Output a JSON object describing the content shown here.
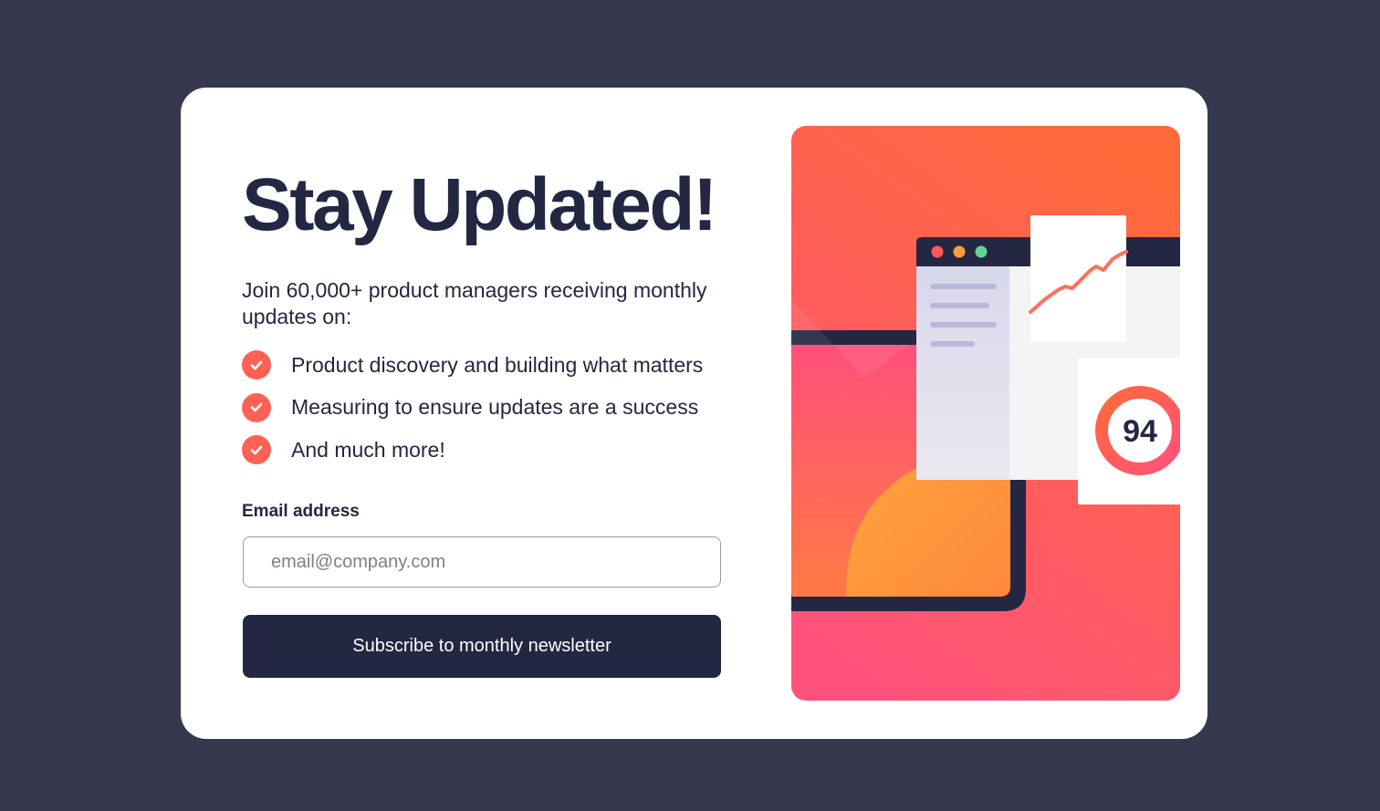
{
  "title": "Stay Updated!",
  "intro": "Join 60,000+ product managers receiving monthly updates on:",
  "features": [
    {
      "text": "Product discovery and building what matters",
      "icon": "check-icon"
    },
    {
      "text": "Measuring to ensure updates are a success",
      "icon": "check-icon"
    },
    {
      "text": "And much more!",
      "icon": "check-icon"
    }
  ],
  "form": {
    "email_label": "Email address",
    "email_placeholder": "email@company.com",
    "email_value": "",
    "submit_label": "Subscribe to monthly newsletter"
  },
  "illustration": {
    "score": "94"
  },
  "colors": {
    "background": "#36384e",
    "dark_navy": "#242742",
    "tomato": "#ff6155",
    "gradient_top": "#ff6a3a",
    "gradient_bottom": "#ff527b"
  }
}
